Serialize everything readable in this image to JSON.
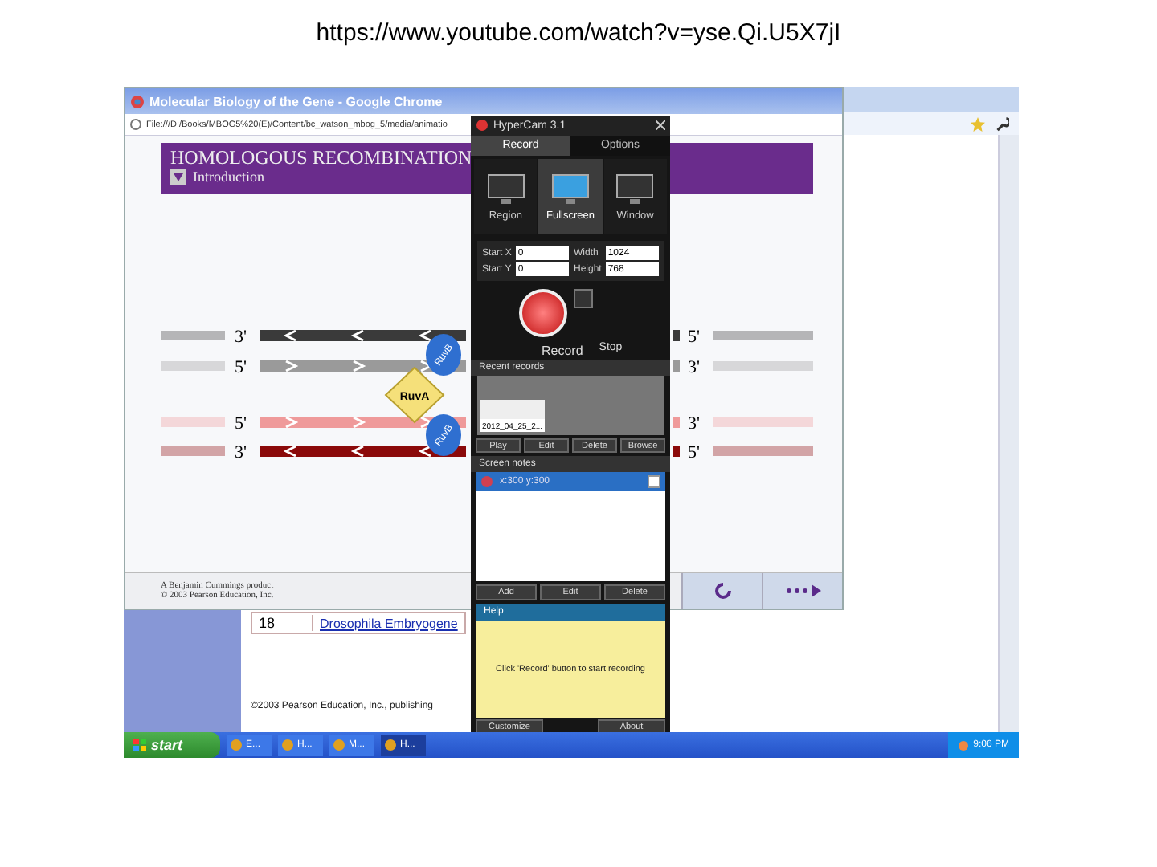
{
  "caption": "https://www.youtube.com/watch?v=yse.Qi.U5X7jI",
  "back_page": {
    "row_number": "18",
    "row_link": "Drosophila Embryogene",
    "footer": "©2003 Pearson Education, Inc., publishing"
  },
  "browser": {
    "title": "Molecular Biology of the Gene - Google Chrome",
    "address": "File:///D:/Books/MBOG5%20(E)/Content/bc_watson_mbog_5/media/animatio",
    "banner_title": "HOMOLOGOUS RECOMBINATION",
    "section": "Introduction",
    "strands": [
      {
        "left": "3'",
        "right": "5'",
        "color": "#3a3a3a"
      },
      {
        "left": "5'",
        "right": "3'",
        "color": "#9a9a9a"
      },
      {
        "left": "5'",
        "right": "3'",
        "color": "#ef9a9a"
      },
      {
        "left": "3'",
        "right": "5'",
        "color": "#8b0a0a"
      }
    ],
    "proteins": [
      {
        "kind": "ruva",
        "label": "RuvA"
      },
      {
        "kind": "ruvb",
        "label": "RuvB"
      },
      {
        "kind": "ruvb",
        "label": "RuvB"
      }
    ],
    "credits": [
      "A Benjamin Cummings product",
      "© 2003 Pearson Education, Inc."
    ]
  },
  "hypercam": {
    "title": "HyperCam 3.1",
    "tabs": [
      {
        "label": "Record",
        "selected": true
      },
      {
        "label": "Options",
        "selected": false
      }
    ],
    "modes": [
      {
        "label": "Region",
        "selected": false
      },
      {
        "label": "Fullscreen",
        "selected": true
      },
      {
        "label": "Window",
        "selected": false
      }
    ],
    "fields": [
      {
        "label": "Start X",
        "value": "0"
      },
      {
        "label": "Width",
        "value": "1024"
      },
      {
        "label": "Start Y",
        "value": "0"
      },
      {
        "label": "Height",
        "value": "768"
      }
    ],
    "record_label": "Record",
    "stop_label": "Stop",
    "recent_title": "Recent records",
    "recent_items": [
      "2012_04_25_2..."
    ],
    "record_buttons": [
      "Play",
      "Edit",
      "Delete",
      "Browse"
    ],
    "notes_title": "Screen notes",
    "notes": [
      {
        "text": "x:300 y:300",
        "checked": false
      }
    ],
    "note_buttons": [
      "Add",
      "Edit",
      "Delete"
    ],
    "help_title": "Help",
    "help_text": "Click 'Record' button to start recording",
    "footer_buttons": [
      "Customize",
      "About"
    ]
  },
  "taskbar": {
    "start": "start",
    "items": [
      {
        "label": "E...",
        "selected": false
      },
      {
        "label": "H...",
        "selected": false
      },
      {
        "label": "M...",
        "selected": false
      },
      {
        "label": "H...",
        "selected": true
      }
    ],
    "clock": "9:06 PM"
  }
}
